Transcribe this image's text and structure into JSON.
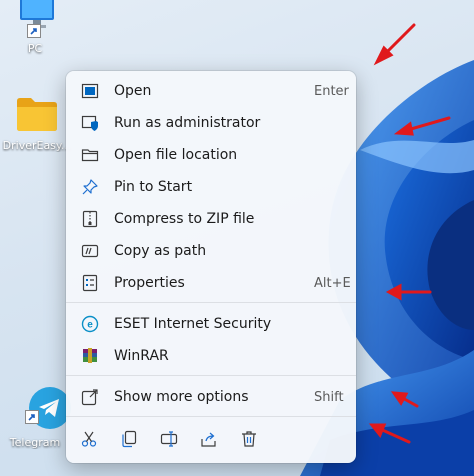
{
  "desktop": {
    "icons": [
      {
        "label": "PC",
        "icon": "monitor-icon"
      },
      {
        "label": "DriverEasy...",
        "icon": "folder-icon"
      },
      {
        "label": "Telegram",
        "icon": "telegram-icon"
      }
    ]
  },
  "context_menu": {
    "items": [
      {
        "label": "Open",
        "shortcut": "Enter",
        "icon": "open-window-icon"
      },
      {
        "label": "Run as administrator",
        "shortcut": "",
        "icon": "shield-window-icon"
      },
      {
        "label": "Open file location",
        "shortcut": "",
        "icon": "folder-outline-icon"
      },
      {
        "label": "Pin to Start",
        "shortcut": "",
        "icon": "pin-icon"
      },
      {
        "label": "Compress to ZIP file",
        "shortcut": "",
        "icon": "zip-icon"
      },
      {
        "label": "Copy as path",
        "shortcut": "",
        "icon": "copy-path-icon"
      },
      {
        "label": "Properties",
        "shortcut": "Alt+E",
        "icon": "properties-icon"
      },
      {
        "label": "ESET Internet Security",
        "shortcut": "",
        "icon": "eset-icon"
      },
      {
        "label": "WinRAR",
        "shortcut": "",
        "icon": "winrar-icon"
      },
      {
        "label": "Show more options",
        "shortcut": "Shift",
        "icon": "more-options-icon"
      }
    ],
    "action_bar": [
      "cut-icon",
      "copy-icon",
      "rename-icon",
      "share-icon",
      "delete-icon"
    ]
  },
  "colors": {
    "accent": "#0067c0",
    "annotation_arrow": "#e0191c",
    "menu_background": "#f4f7fb"
  }
}
